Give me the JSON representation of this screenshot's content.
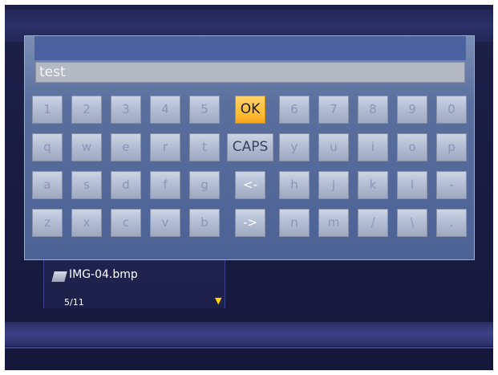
{
  "input": {
    "value": "test"
  },
  "keyboard": {
    "row1": [
      "1",
      "2",
      "3",
      "4",
      "5",
      "OK",
      "6",
      "7",
      "8",
      "9",
      "0"
    ],
    "row2": [
      "q",
      "w",
      "e",
      "r",
      "t",
      "CAPS",
      "y",
      "u",
      "i",
      "o",
      "p"
    ],
    "row3": [
      "a",
      "s",
      "d",
      "f",
      "g",
      "<-",
      "h",
      "j",
      "k",
      "l",
      "-"
    ],
    "row4": [
      "z",
      "x",
      "c",
      "v",
      "b",
      "->",
      "n",
      "m",
      "/",
      "\\",
      "."
    ]
  },
  "file_panel": {
    "file_name": "IMG-04.bmp",
    "page_counter": "5/11",
    "scroll_arrow": "▼"
  },
  "colors": {
    "ok_key": "#ffc83c",
    "dialog": "#5a6f9d",
    "background": "#1b1d45"
  }
}
